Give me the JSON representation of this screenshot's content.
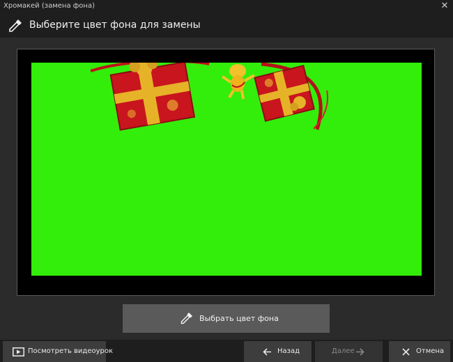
{
  "window": {
    "title": "Хромакей (замена фона)",
    "close_glyph": "✕"
  },
  "header": {
    "title": "Выберите цвет фона для замены",
    "icon": "eyedropper-icon"
  },
  "preview": {
    "background_color": "#33ee0a",
    "content": "green-screen-gift-boxes"
  },
  "pick_color_button": {
    "label": "Выбрать цвет фона",
    "icon": "eyedropper-icon"
  },
  "footer": {
    "tutorial_button": {
      "label": "Посмотреть видеоурок",
      "icon": "play-icon"
    },
    "back_button": {
      "label": "Назад",
      "icon": "arrow-left-icon"
    },
    "next_button": {
      "label": "Далее",
      "icon": "arrow-right-icon",
      "enabled": false
    },
    "cancel_button": {
      "label": "Отмена",
      "icon": "close-icon"
    }
  },
  "colors": {
    "background": "#2b2b2b",
    "bar": "#1e1e1e",
    "button": "#5a5a5a",
    "chroma_green": "#33ee0a"
  }
}
